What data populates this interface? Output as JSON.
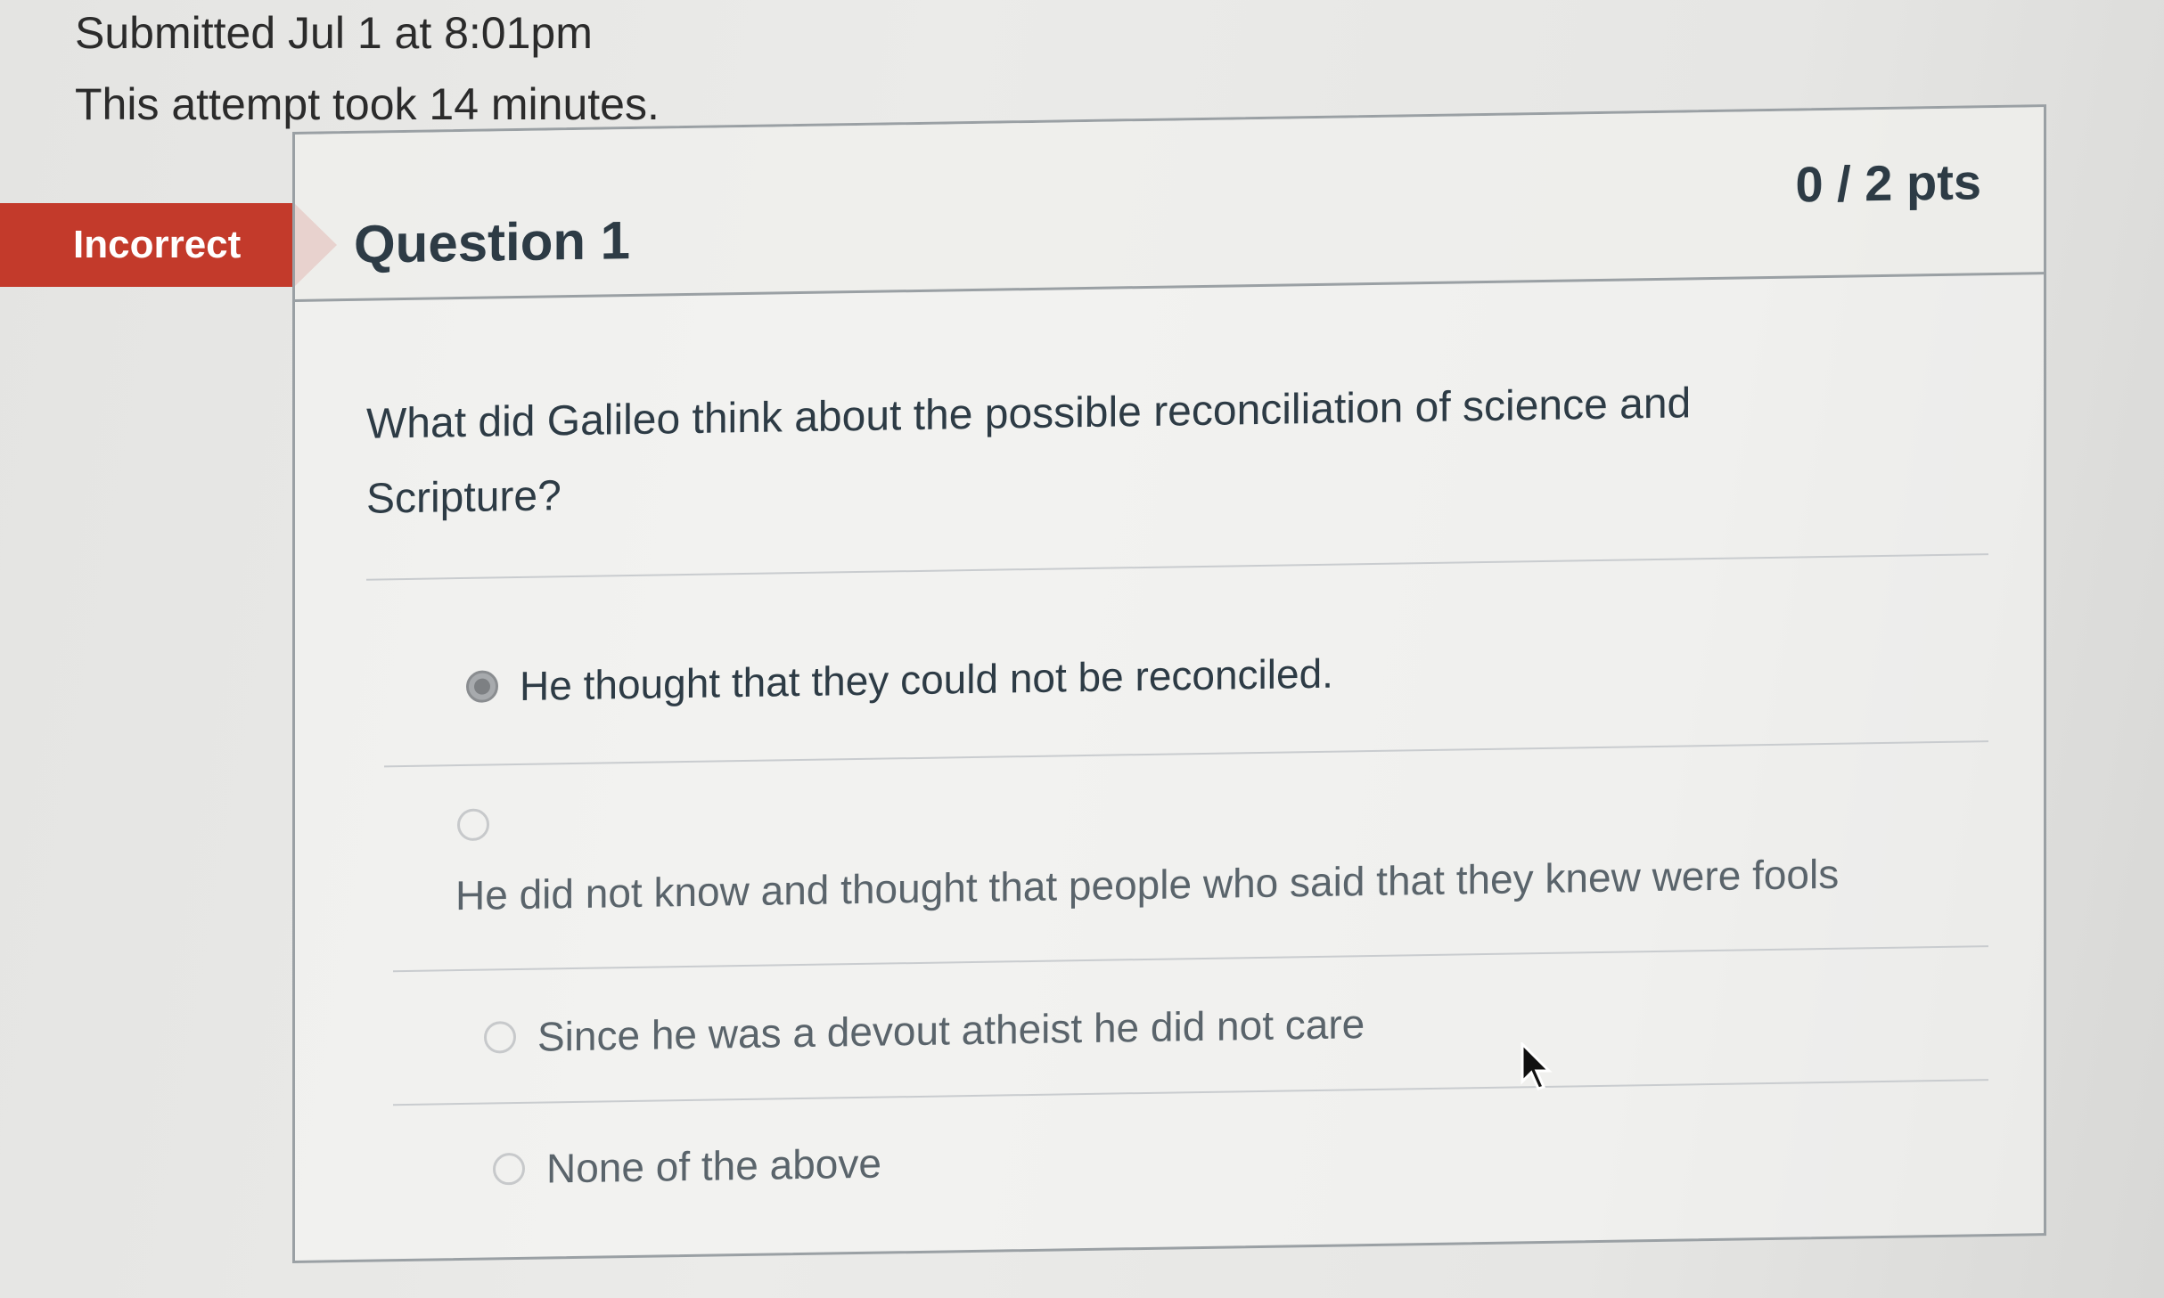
{
  "submission": {
    "submitted": "Submitted Jul 1 at 8:01pm",
    "duration": "This attempt took 14 minutes."
  },
  "question": {
    "status": "Incorrect",
    "title": "Question 1",
    "points": "0 / 2 pts",
    "text": "What did Galileo think about the possible reconciliation of science and Scripture?",
    "answers": [
      {
        "label": "He thought that they could not be reconciled.",
        "selected": true
      },
      {
        "label": "He did not know and thought that people who said that they knew were fools",
        "selected": false
      },
      {
        "label": "Since he was a devout atheist he did not care",
        "selected": false
      },
      {
        "label": "None of the above",
        "selected": false
      }
    ]
  },
  "colors": {
    "incorrect_tag": "#c33a2b",
    "text": "#2d3b45",
    "border": "#9aa0a4"
  },
  "icons": {
    "cursor": "mouse-pointer-icon",
    "radio": "radio-button-icon"
  }
}
